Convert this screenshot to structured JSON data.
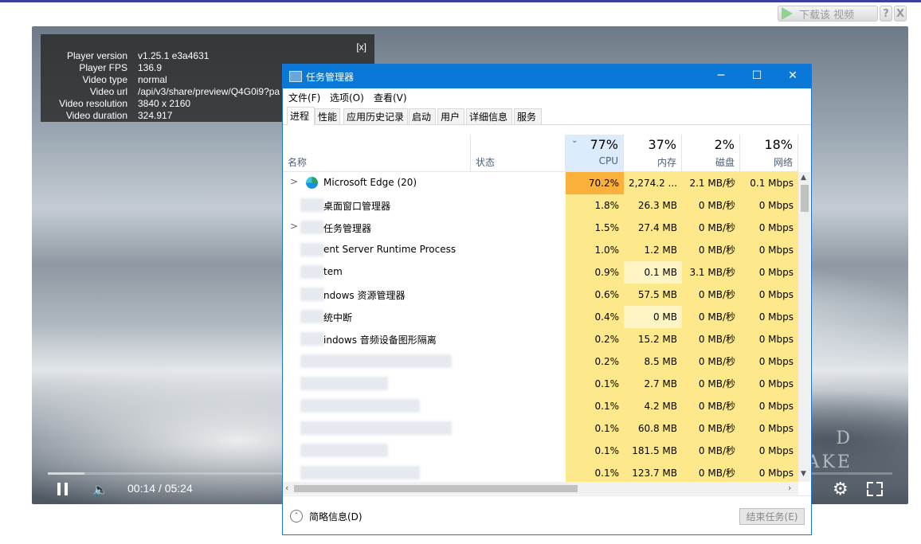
{
  "download_widget": {
    "label": "下载该 视频",
    "help": "?",
    "close": "X"
  },
  "player": {
    "stats": [
      {
        "key": "Player version",
        "value": "v1.25.1 e3a4631"
      },
      {
        "key": "Player FPS",
        "value": "136.9"
      },
      {
        "key": "Video type",
        "value": "normal"
      },
      {
        "key": "Video url",
        "value": "/api/v3/share/preview/Q4G0i9?pa"
      },
      {
        "key": "Video resolution",
        "value": "3840 x 2160"
      },
      {
        "key": "Video duration",
        "value": "324.917"
      }
    ],
    "stats_close": "[x]",
    "time": "00:14 / 05:24",
    "progress_fraction": 0.043,
    "watermark_lines": [
      "D",
      "AKE"
    ]
  },
  "task_manager": {
    "title": "任务管理器",
    "window_buttons": {
      "minimize": "─",
      "maximize": "☐",
      "close": "✕"
    },
    "menu": [
      "文件(F)",
      "选项(O)",
      "查看(V)"
    ],
    "tabs": [
      "进程",
      "性能",
      "应用历史记录",
      "启动",
      "用户",
      "详细信息",
      "服务"
    ],
    "active_tab": "进程",
    "columns": {
      "name": "名称",
      "status": "状态",
      "cpu": {
        "pct": "77%",
        "label": "CPU"
      },
      "mem": {
        "pct": "37%",
        "label": "内存"
      },
      "disk": {
        "pct": "2%",
        "label": "磁盘"
      },
      "net": {
        "pct": "18%",
        "label": "网络"
      }
    },
    "rows": [
      {
        "name": "Microsoft Edge (20)",
        "expand": ">",
        "cpu": "70.2%",
        "mem": "2,274.2 ...",
        "disk": "2.1 MB/秒",
        "net": "0.1 Mbps"
      },
      {
        "name": "桌面窗口管理器",
        "expand": "",
        "cpu": "1.8%",
        "mem": "26.3 MB",
        "disk": "0 MB/秒",
        "net": "0 Mbps"
      },
      {
        "name": "任务管理器",
        "expand": ">",
        "cpu": "1.5%",
        "mem": "27.4 MB",
        "disk": "0 MB/秒",
        "net": "0 Mbps"
      },
      {
        "name": "ent Server Runtime Process",
        "expand": "",
        "cpu": "1.0%",
        "mem": "1.2 MB",
        "disk": "0 MB/秒",
        "net": "0 Mbps"
      },
      {
        "name": "tem",
        "expand": "",
        "cpu": "0.9%",
        "mem": "0.1 MB",
        "disk": "3.1 MB/秒",
        "net": "0 Mbps"
      },
      {
        "name": "ndows 资源管理器",
        "expand": "",
        "cpu": "0.6%",
        "mem": "57.5 MB",
        "disk": "0 MB/秒",
        "net": "0 Mbps"
      },
      {
        "name": "统中断",
        "expand": "",
        "cpu": "0.4%",
        "mem": "0 MB",
        "disk": "0 MB/秒",
        "net": "0 Mbps"
      },
      {
        "name": "indows 音频设备图形隔离",
        "expand": "",
        "cpu": "0.2%",
        "mem": "15.2 MB",
        "disk": "0 MB/秒",
        "net": "0 Mbps"
      },
      {
        "name": "",
        "expand": "",
        "cpu": "0.2%",
        "mem": "8.5 MB",
        "disk": "0 MB/秒",
        "net": "0 Mbps"
      },
      {
        "name": "",
        "expand": "",
        "cpu": "0.1%",
        "mem": "2.7 MB",
        "disk": "0 MB/秒",
        "net": "0 Mbps"
      },
      {
        "name": "",
        "expand": "",
        "cpu": "0.1%",
        "mem": "4.2 MB",
        "disk": "0 MB/秒",
        "net": "0 Mbps"
      },
      {
        "name": "",
        "expand": "",
        "cpu": "0.1%",
        "mem": "60.8 MB",
        "disk": "0 MB/秒",
        "net": "0 Mbps"
      },
      {
        "name": "",
        "expand": "",
        "cpu": "0.1%",
        "mem": "181.5 MB",
        "disk": "0 MB/秒",
        "net": "0 Mbps"
      },
      {
        "name": "",
        "expand": "",
        "cpu": "0.1%",
        "mem": "123.7 MB",
        "disk": "0 MB/秒",
        "net": "0 Mbps"
      }
    ],
    "footer": {
      "brief": "简略信息(D)",
      "end_task": "结束任务(E)"
    },
    "colors": {
      "heat_high": "#fbb03b",
      "heat_mid": "#fde88c",
      "heat_low": "#fff4c4",
      "titlebar": "#0a78d7"
    }
  }
}
